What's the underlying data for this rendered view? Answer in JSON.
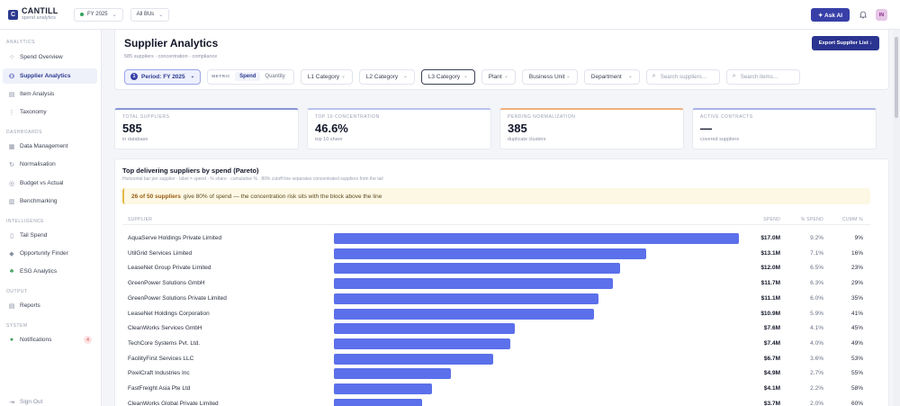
{
  "app": {
    "logo_letter": "C",
    "name": "CANTILL",
    "tagline": "spend analytics"
  },
  "topbar": {
    "fy_label": "FY 2025",
    "bu_label": "All BUs",
    "ask_ai_label": "✦ Ask AI",
    "avatar_initials": "IN"
  },
  "sidebar": {
    "sections": [
      {
        "title": "ANALYTICS",
        "items": [
          {
            "label": "Spend Overview",
            "icon": "circle-icon"
          },
          {
            "label": "Supplier Analytics",
            "icon": "users-icon",
            "active": true
          },
          {
            "label": "Item Analysis",
            "icon": "box-icon"
          },
          {
            "label": "Taxonomy",
            "icon": "tree-icon"
          }
        ]
      },
      {
        "title": "DASHBOARDS",
        "items": [
          {
            "label": "Data Management",
            "icon": "grid-icon"
          },
          {
            "label": "Normalisation",
            "icon": "refresh-icon"
          },
          {
            "label": "Budget vs Actual",
            "icon": "target-icon"
          },
          {
            "label": "Benchmarking",
            "icon": "chart-icon"
          }
        ]
      },
      {
        "title": "INTELLIGENCE",
        "items": [
          {
            "label": "Tail Spend",
            "icon": "doc-icon"
          },
          {
            "label": "Opportunity Finder",
            "icon": "diamond-icon"
          },
          {
            "label": "ESG Analytics",
            "icon": "leaf-icon"
          }
        ]
      },
      {
        "title": "OUTPUT",
        "items": [
          {
            "label": "Reports",
            "icon": "report-icon"
          }
        ]
      },
      {
        "title": "SYSTEM",
        "items": [
          {
            "label": "Notifications",
            "icon": "bell-dot-icon",
            "badge": "4"
          }
        ]
      }
    ],
    "sign_out": "Sign Out"
  },
  "page": {
    "title": "Supplier Analytics",
    "subtitle": "585 suppliers · concentration · compliance",
    "export_label": "Export Supplier List ↓"
  },
  "filters": {
    "period_num": "1",
    "period_label": "Period: FY 2025",
    "metric_label": "METRIC",
    "metric_options": [
      "Spend",
      "Quantity"
    ],
    "l1": "L1 Category",
    "l2": "L2 Category",
    "l3": "L3 Category",
    "plant": "Plant",
    "business_unit": "Business Unit",
    "department": "Department",
    "search_suppliers_placeholder": "Search suppliers…",
    "search_items_placeholder": "Search items…"
  },
  "kpis": [
    {
      "label": "TOTAL SUPPLIERS",
      "value": "585",
      "sub": "in database"
    },
    {
      "label": "TOP 10 CONCENTRATION",
      "value": "46.6%",
      "sub": "top 10 share"
    },
    {
      "label": "PENDING NORMALIZATION",
      "value": "385",
      "sub": "duplicate clusters"
    },
    {
      "label": "ACTIVE CONTRACTS",
      "value": "—",
      "sub": "covered suppliers"
    }
  ],
  "pareto": {
    "title": "Top delivering suppliers by spend (Pareto)",
    "subtitle": "Horizontal bar per supplier · label = spend · % share · cumulative % · 80% cutoff line separates concentrated suppliers from the tail",
    "callout_bold": "26 of 50 suppliers",
    "callout_text": "give 80% of spend — the concentration risk sits with the block above the line",
    "columns": {
      "supplier": "SUPPLIER",
      "spend": "SPEND",
      "pct": "% SPEND",
      "cum": "CUMM %"
    },
    "bar_color": "#5b70ea"
  },
  "chart_data": {
    "type": "bar",
    "orientation": "horizontal",
    "categories": [
      "AquaServe Holdings Private Limited",
      "UtilGrid Services Limited",
      "LeaseNet Group Private Limited",
      "GreenPower Solutions GmbH",
      "GreenPower Solutions Private Limited",
      "LeaseNet Holdings Corporation",
      "CleanWorks Services GmbH",
      "TechCore Systems Pvt. Ltd.",
      "FacilityFirst Services LLC",
      "PixelCraft Industries Inc",
      "FastFreight Asia Pte Ltd",
      "CleanWorks Global Private Limited"
    ],
    "values": [
      17.0,
      13.1,
      12.0,
      11.7,
      11.1,
      10.9,
      7.6,
      7.4,
      6.7,
      4.9,
      4.1,
      3.7
    ],
    "spend_labels": [
      "$17.0M",
      "$13.1M",
      "$12.0M",
      "$11.7M",
      "$11.1M",
      "$10.9M",
      "$7.6M",
      "$7.4M",
      "$6.7M",
      "$4.9M",
      "$4.1M",
      "$3.7M"
    ],
    "pct_spend": [
      "9.2%",
      "7.1%",
      "6.5%",
      "6.3%",
      "6.0%",
      "5.9%",
      "4.1%",
      "4.0%",
      "3.6%",
      "2.7%",
      "2.2%",
      "2.0%"
    ],
    "cum_pct": [
      "9%",
      "16%",
      "23%",
      "29%",
      "35%",
      "41%",
      "45%",
      "49%",
      "53%",
      "55%",
      "58%",
      "60%"
    ],
    "xlim": [
      0,
      17.0
    ]
  }
}
